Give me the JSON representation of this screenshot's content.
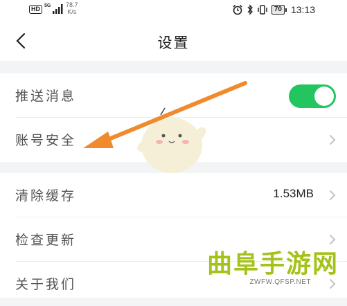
{
  "status_bar": {
    "hd": "HD",
    "network": "5G",
    "speed_value": "78.7",
    "speed_unit": "K/s",
    "battery": "70",
    "time": "13:13"
  },
  "nav": {
    "title": "设置",
    "back_icon": "chevron-left-icon"
  },
  "groups": [
    {
      "rows": [
        {
          "label": "推送消息",
          "type": "toggle",
          "on": true
        },
        {
          "label": "账号安全",
          "type": "link"
        }
      ]
    },
    {
      "rows": [
        {
          "label": "清除缓存",
          "type": "value",
          "value": "1.53MB"
        },
        {
          "label": "检查更新",
          "type": "link"
        },
        {
          "label": "关于我们",
          "type": "link"
        }
      ]
    }
  ],
  "colors": {
    "toggle_on": "#22c55e",
    "arrow": "#f08a2c",
    "background": "#f3f4f6"
  },
  "watermark": {
    "text": "曲阜手游网",
    "url": "ZWFW.QFSP.NET"
  }
}
